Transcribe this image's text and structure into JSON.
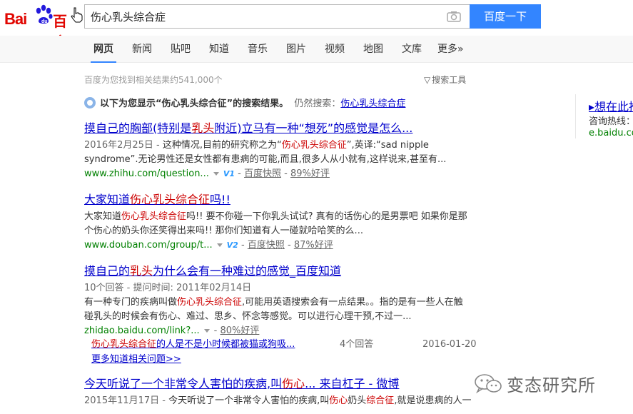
{
  "header": {
    "logo_text_left": "Bai",
    "logo_text_right": "百度",
    "search_value": "伤心乳头综合症",
    "search_button": "百度一下"
  },
  "tabs": [
    "网页",
    "新闻",
    "贴吧",
    "知道",
    "音乐",
    "图片",
    "视频",
    "地图",
    "文库",
    "更多»"
  ],
  "stats": "百度为您找到相关结果约541,000个",
  "tools_label": "搜索工具",
  "correction": {
    "prefix": "以下为您显示“",
    "term": "伤心乳头综合征",
    "mid": "”的搜索结果。",
    "still": "仍然搜索：",
    "original": "伤心乳头综合症"
  },
  "results": [
    {
      "title_parts": [
        "摸自己的胸部(特别是",
        "乳头",
        "附近)立马有一种“想死”的感觉是怎么..."
      ],
      "abstract_date": "2016年2月25日 - ",
      "abstract_parts": [
        "这种情况,目前的研究称之为“",
        "伤心乳头综合征",
        "”,英译:“sad nipple syndrome”.无论男性还是女性都有患病的可能,而且,很多人从小就有,这样说来,甚至有..."
      ],
      "url": "www.zhihu.com/question...",
      "badge": "V1",
      "snapshot": "百度快照",
      "rating": "89%好评"
    },
    {
      "title_parts": [
        "大家知道",
        "伤心乳头综合征",
        "吗!!"
      ],
      "abstract_parts": [
        "大家知道",
        "伤心乳头综合征",
        "吗!! 要不你碰一下你乳头试试? 真有的话伤心的是男票吧 如果你是那个伤心的奶头你还笑得出来吗!! 那你们知道有人一碰就哈哈笑的么..."
      ],
      "url": "www.douban.com/group/t...",
      "badge": "V2",
      "snapshot": "百度快照",
      "rating": "87%好评"
    },
    {
      "title_parts": [
        "摸自己的",
        "乳头",
        "为什么会有一种难过的感觉_百度知道"
      ],
      "meta": "10个回答 - 提问时间: 2011年02月14日",
      "abstract_parts": [
        "有一种专门的疾病叫做",
        "伤心乳头综合征",
        ",可能用英语搜索会有一点结果。。指的是有一些人在触碰乳头的时候会有伤心、难过、思乡、怀念等感觉。可以进行心理干预,不过一..."
      ],
      "url": "zhidao.baidu.com/link?...",
      "rating": "80%好评",
      "sub_question_parts": [
        "伤心乳头综合征",
        "的人是不是小时候都被猫或狗吸..."
      ],
      "sub_count": "4个回答",
      "sub_date": "2016-01-20",
      "more": "更多知道相关问题>>"
    },
    {
      "title_parts": [
        "今天听说了一个非常令人害怕的疾病,叫",
        "伤心",
        "... 来自杠子 - 微博"
      ],
      "abstract_date": "2015年11月17日 - ",
      "abstract_parts": [
        "今天听说了一个非常令人害怕的疾病,叫",
        "伤心",
        "奶头",
        "综合征",
        ",就是说患病的人一"
      ]
    }
  ],
  "side": {
    "title": "▸想在此推",
    "line": "咨询热线：",
    "url": "e.baidu.co"
  },
  "watermark": "变态研究所",
  "colors": {
    "brand_red": "#e10601",
    "brand_blue": "#2319dc",
    "button_blue": "#3385ff",
    "link_blue": "#0000cc",
    "highlight_red": "#cc0000",
    "url_green": "#008000"
  }
}
